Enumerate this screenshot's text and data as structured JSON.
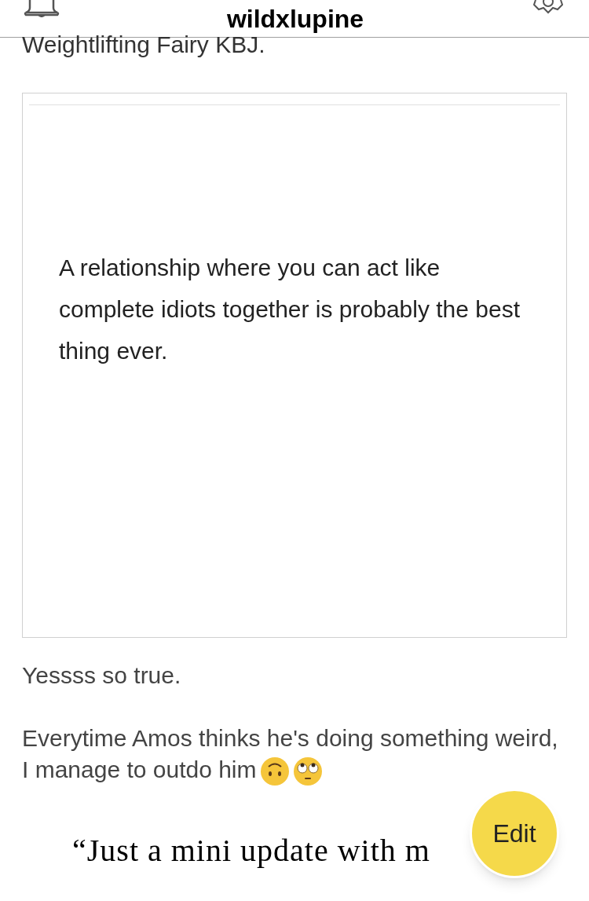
{
  "header": {
    "title": "wildxlupine"
  },
  "post": {
    "intro": "Weightlifting Fairy KBJ.",
    "quote_image": {
      "text": "A relationship where you can act like complete idiots together is probably the best thing ever."
    },
    "paragraphs": [
      "Yessss so true.",
      "Everytime Amos thinks he's doing something weird, I manage to outdo him"
    ],
    "next_heading": "“Just a mini update with m"
  },
  "edit_button": {
    "label": "Edit"
  }
}
